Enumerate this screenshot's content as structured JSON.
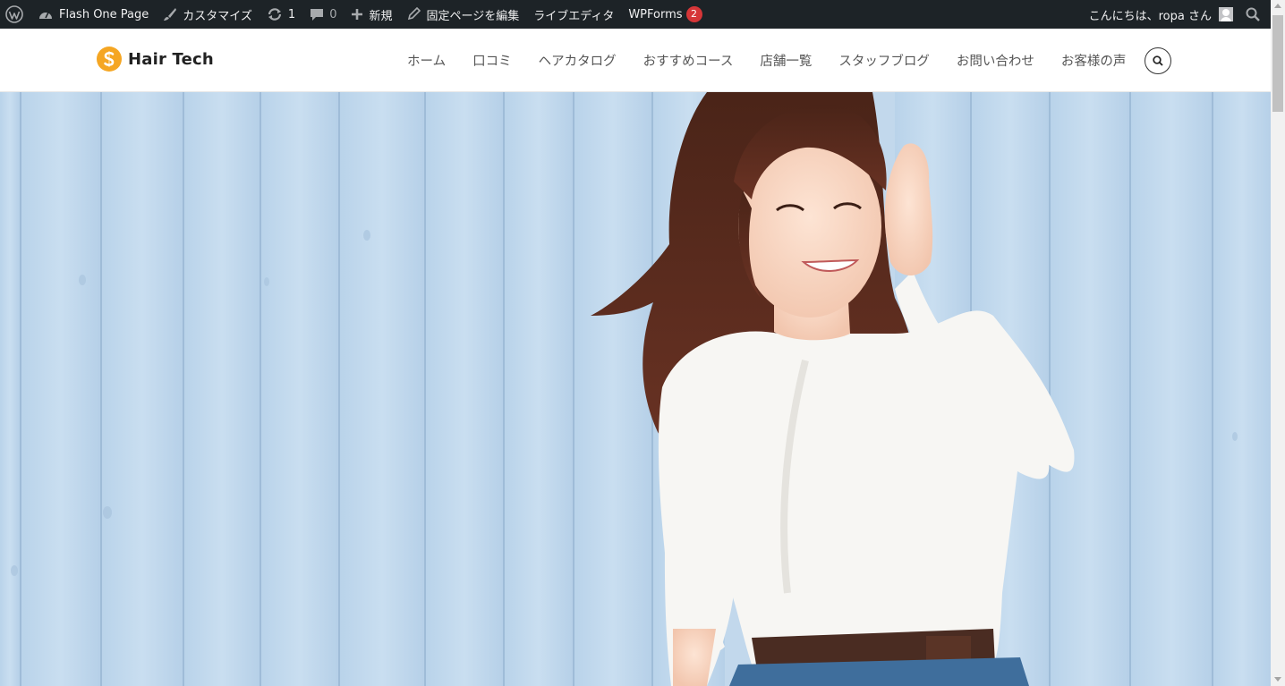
{
  "admin_bar": {
    "site_name": "Flash One Page",
    "customize": "カスタマイズ",
    "updates_count": "1",
    "comments_count": "0",
    "new": "新規",
    "edit_page": "固定ページを編集",
    "live_editor": "ライブエディタ",
    "wpforms": "WPForms",
    "wpforms_badge": "2",
    "greeting": "こんにちは、ropa さん"
  },
  "site": {
    "title": "Hair Tech",
    "logo_color": "#f5a623"
  },
  "nav": {
    "items": [
      "ホーム",
      "口コミ",
      "ヘアカタログ",
      "おすすめコース",
      "店舗一覧",
      "スタッフブログ",
      "お問い合わせ",
      "お客様の声"
    ]
  },
  "colors": {
    "admin_bar_bg": "#1d2327",
    "hero_bg": "#c3d9ec",
    "badge_red": "#d63638"
  }
}
